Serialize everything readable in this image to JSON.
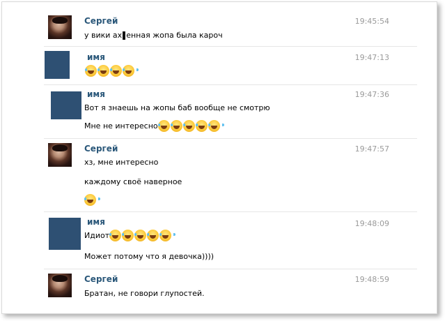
{
  "messages": [
    {
      "sender": "Сергей",
      "time": "19:45:54",
      "avatar": "user-photo",
      "lines": [
        {
          "pre": "у вики ах",
          "post": "енная жопа была кароч"
        }
      ]
    },
    {
      "sender": "имя",
      "time": "19:47:13",
      "avatar": "blue-placeholder",
      "emoji_count": 4,
      "emoji_name": "face-with-tears-of-joy"
    },
    {
      "sender": "имя",
      "time": "19:47:36",
      "avatar": "blue-placeholder",
      "lines": [
        {
          "text": "Вот я знаешь на жопы баб вообще не смотрю"
        },
        {
          "text": "Мне не интересно",
          "emoji_count": 5
        }
      ]
    },
    {
      "sender": "Сергей",
      "time": "19:47:57",
      "avatar": "user-photo",
      "lines": [
        {
          "text": "хз, мне интересно"
        },
        {
          "text": "каждому своё наверное"
        },
        {
          "emoji_count": 1
        }
      ]
    },
    {
      "sender": "имя",
      "time": "19:48:09",
      "avatar": "blue-placeholder",
      "lines": [
        {
          "text": "Идиот",
          "emoji_count": 5
        },
        {
          "text": "Может потому что я девочка))))"
        }
      ]
    },
    {
      "sender": "Сергей",
      "time": "19:48:59",
      "avatar": "user-photo",
      "lines": [
        {
          "text": "Братан, не говори глупостей."
        }
      ]
    }
  ],
  "colors": {
    "name": "#2b587a",
    "time": "#9a9a9a",
    "avatar_placeholder": "#2e5073",
    "separator": "#e6e6e6"
  }
}
